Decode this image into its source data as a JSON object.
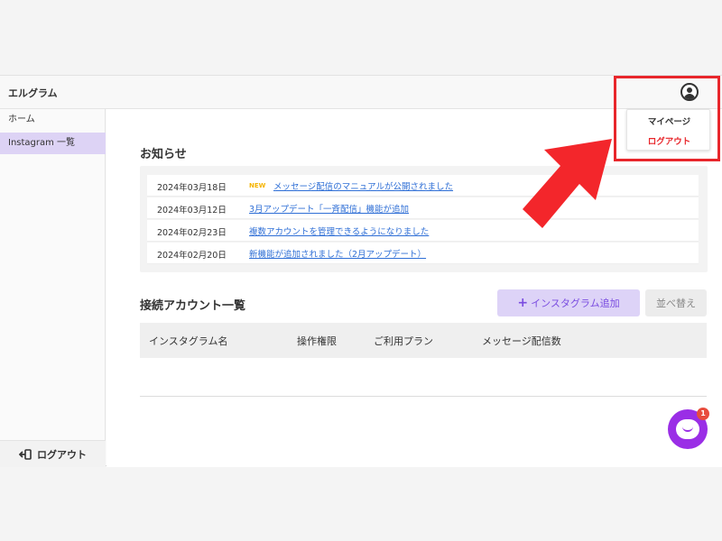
{
  "header": {
    "title": "エルグラム",
    "avatar_icon": "user-circle-icon"
  },
  "sidebar": {
    "items": [
      {
        "label": "ホーム",
        "active": false
      },
      {
        "label": "Instagram 一覧",
        "active": true
      }
    ],
    "logout_label": "ログアウト",
    "logout_icon": "logout-icon"
  },
  "news": {
    "title": "お知らせ",
    "items": [
      {
        "date": "2024年03月18日",
        "badge": "NEW",
        "text": "メッセージ配信のマニュアルが公開されました"
      },
      {
        "date": "2024年03月12日",
        "badge": "",
        "text": "3月アップデート「一斉配信」機能が追加"
      },
      {
        "date": "2024年02月23日",
        "badge": "",
        "text": "複数アカウントを管理できるようになりました"
      },
      {
        "date": "2024年02月20日",
        "badge": "",
        "text": "新機能が追加されました（2月アップデート）"
      }
    ]
  },
  "accounts": {
    "title": "接続アカウント一覧",
    "add_button": "インスタグラム追加",
    "add_icon": "plus-icon",
    "sort_button": "並べ替え",
    "columns": [
      "インスタグラム名",
      "操作権限",
      "ご利用プラン",
      "メッセージ配信数"
    ]
  },
  "dropdown": {
    "items": [
      {
        "label": "マイページ",
        "color": "#333333"
      },
      {
        "label": "ログアウト",
        "color": "#e8262b"
      }
    ]
  },
  "chat": {
    "icon": "chat-bubble-icon",
    "badge_count": "1"
  },
  "colors": {
    "accent": "#7a4ce0",
    "accent_bg": "#ddd3f7",
    "annotation_red": "#e8262b",
    "link": "#2f6fd6",
    "new_badge": "#f5b400",
    "chat_purple": "#9a2ee6"
  }
}
